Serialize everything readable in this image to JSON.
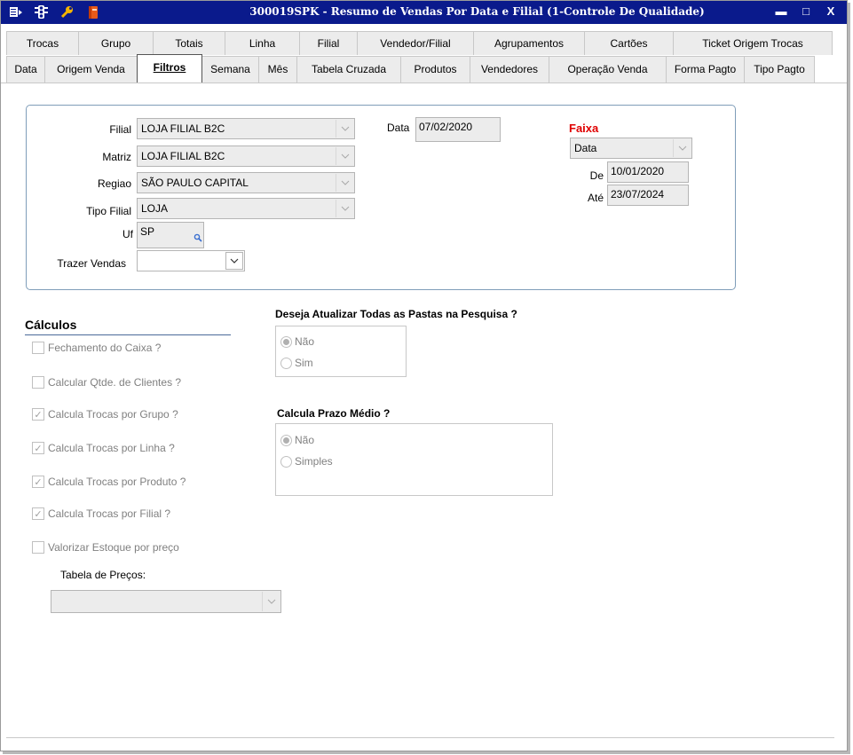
{
  "window": {
    "title": "300019SPK - Resumo de Vendas Por Data e Filial (1-Controle De Qualidade)",
    "icons": [
      "menu-icon",
      "traffic-light-icon",
      "wrench-icon",
      "book-icon"
    ],
    "controls": {
      "minimize": "▬",
      "maximize": "□",
      "close": "X"
    },
    "title_bg": "#0a1a8c"
  },
  "tabs_row1": [
    {
      "label": "Trocas",
      "width": 82
    },
    {
      "label": "Grupo",
      "width": 85
    },
    {
      "label": "Totais",
      "width": 82
    },
    {
      "label": "Linha",
      "width": 85
    },
    {
      "label": "Filial",
      "width": 66
    },
    {
      "label": "Vendedor/Filial",
      "width": 132
    },
    {
      "label": "Agrupamentos",
      "width": 126
    },
    {
      "label": "Cartões",
      "width": 101
    },
    {
      "label": "Ticket Origem Trocas",
      "width": 180
    }
  ],
  "tabs_row2": [
    {
      "label": "Data",
      "width": 44
    },
    {
      "label": "Origem Venda",
      "width": 105
    },
    {
      "label": "Filtros",
      "width": 74,
      "active": true
    },
    {
      "label": "Semana",
      "width": 65
    },
    {
      "label": "Mês",
      "width": 44
    },
    {
      "label": "Tabela Cruzada",
      "width": 118
    },
    {
      "label": "Produtos",
      "width": 79
    },
    {
      "label": "Vendedores",
      "width": 90
    },
    {
      "label": "Operação Venda",
      "width": 133
    },
    {
      "label": "Forma Pagto",
      "width": 89
    },
    {
      "label": "Tipo Pagto",
      "width": 80
    }
  ],
  "filters": {
    "filial_label": "Filial",
    "filial_value": "LOJA FILIAL B2C",
    "matriz_label": "Matriz",
    "matriz_value": "LOJA FILIAL B2C",
    "regiao_label": "Regiao",
    "regiao_value": "SÃO PAULO CAPITAL",
    "tipo_filial_label": "Tipo Filial",
    "tipo_filial_value": "LOJA",
    "uf_label": "Uf",
    "uf_value": "SP",
    "trazer_vendas_label": "Trazer Vendas",
    "trazer_vendas_value": "",
    "data_label": "Data",
    "data_value": "07/02/2020",
    "faixa_label": "Faixa",
    "faixa_value": "Data",
    "de_label": "De",
    "de_value": "10/01/2020",
    "ate_label": "Até",
    "ate_value": "23/07/2024"
  },
  "calculos": {
    "title": "Cálculos",
    "items": [
      {
        "label": "Fechamento do Caixa ?",
        "checked": false
      },
      {
        "label": "Calcular Qtde. de Clientes ?",
        "checked": false
      },
      {
        "label": "Calcula Trocas por Grupo ?",
        "checked": true
      },
      {
        "label": "Calcula Trocas por Linha ?",
        "checked": true
      },
      {
        "label": "Calcula Trocas por Produto ?",
        "checked": true
      },
      {
        "label": "Calcula Trocas por Filial ?",
        "checked": true
      },
      {
        "label": "Valorizar Estoque por preço",
        "checked": false
      }
    ],
    "tabela_precos_label": "Tabela de Preços:",
    "tabela_precos_value": ""
  },
  "atualizar_pastas": {
    "question": "Deseja Atualizar Todas as Pastas na Pesquisa ?",
    "options": [
      {
        "label": "Não",
        "selected": true
      },
      {
        "label": "Sim",
        "selected": false
      }
    ]
  },
  "prazo_medio": {
    "question": "Calcula Prazo Médio ?",
    "options": [
      {
        "label": "Não",
        "selected": true
      },
      {
        "label": "Simples",
        "selected": false
      }
    ]
  },
  "checkmark": "✓"
}
